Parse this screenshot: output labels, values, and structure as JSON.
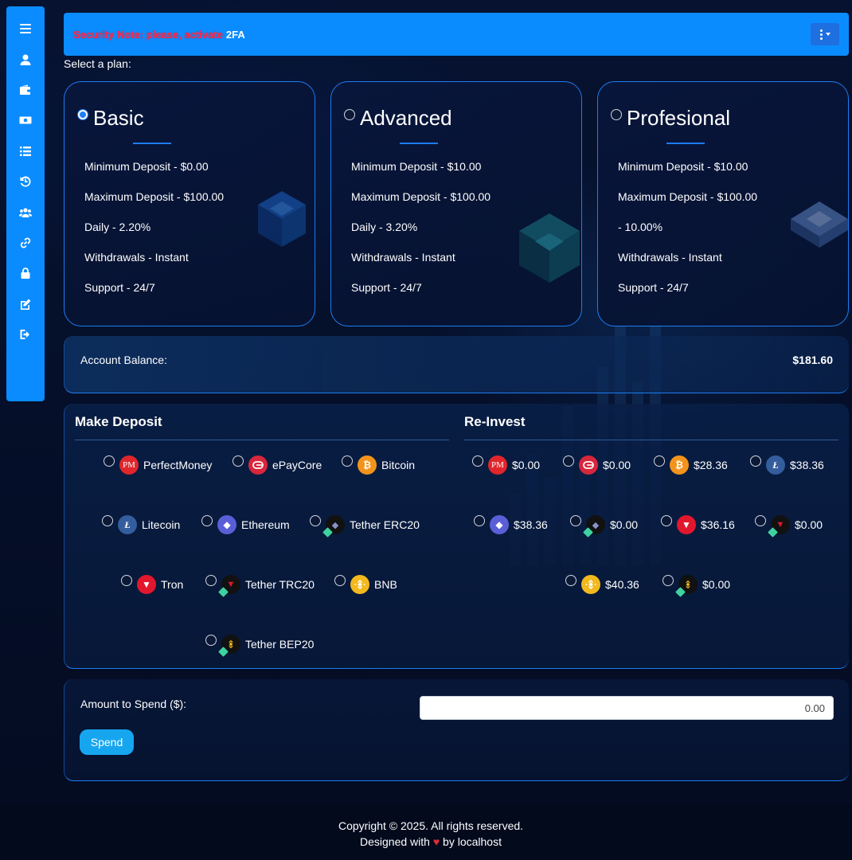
{
  "topbar": {
    "security_note": "Security Note: please, activate",
    "fa_link": "2FA"
  },
  "sidebar": {
    "items": [
      {
        "icon": "menu-icon"
      },
      {
        "icon": "user-icon"
      },
      {
        "icon": "wallet-icon"
      },
      {
        "icon": "money-icon"
      },
      {
        "icon": "list-icon"
      },
      {
        "icon": "history-icon"
      },
      {
        "icon": "users-icon"
      },
      {
        "icon": "link-icon"
      },
      {
        "icon": "lock-icon"
      },
      {
        "icon": "edit-icon"
      },
      {
        "icon": "logout-icon"
      }
    ]
  },
  "plans": {
    "label": "Select a plan:",
    "items": [
      {
        "name": "Basic",
        "selected": true,
        "lines": [
          "Minimum Deposit - $0.00",
          "Maximum Deposit - $100.00",
          "Daily - 2.20%",
          "Withdrawals - Instant",
          "Support - 24/7"
        ]
      },
      {
        "name": "Advanced",
        "selected": false,
        "lines": [
          "Minimum Deposit - $10.00",
          "Maximum Deposit - $100.00",
          "Daily - 3.20%",
          "Withdrawals - Instant",
          "Support - 24/7"
        ]
      },
      {
        "name": "Profesional",
        "selected": false,
        "lines": [
          "Minimum Deposit - $10.00",
          "Maximum Deposit - $100.00",
          "- 10.00%",
          "Withdrawals - Instant",
          "Support - 24/7"
        ]
      }
    ]
  },
  "balance": {
    "label": "Account Balance:",
    "value": "$181.60"
  },
  "deposit": {
    "title": "Make Deposit",
    "options": [
      {
        "label": "PerfectMoney",
        "coin": "pm"
      },
      {
        "label": "ePayCore",
        "coin": "epay"
      },
      {
        "label": "Bitcoin",
        "coin": "btc"
      },
      {
        "label": "Litecoin",
        "coin": "ltc"
      },
      {
        "label": "Ethereum",
        "coin": "eth"
      },
      {
        "label": "Tether ERC20",
        "coin": "usdt"
      },
      {
        "label": "Tron",
        "coin": "trx"
      },
      {
        "label": "Tether TRC20",
        "coin": "usdt-trc"
      },
      {
        "label": "BNB",
        "coin": "bnb"
      },
      {
        "label": "Tether BEP20",
        "coin": "usdt-bep"
      }
    ]
  },
  "reinvest": {
    "title": "Re-Invest",
    "options": [
      {
        "coin": "pm",
        "amount": "$0.00"
      },
      {
        "coin": "epay",
        "amount": "$0.00"
      },
      {
        "coin": "btc",
        "amount": "$28.36"
      },
      {
        "coin": "ltc",
        "amount": "$38.36"
      },
      {
        "coin": "eth",
        "amount": "$38.36"
      },
      {
        "coin": "usdt",
        "amount": "$0.00"
      },
      {
        "coin": "trx",
        "amount": "$36.16"
      },
      {
        "coin": "usdt-trc",
        "amount": "$0.00"
      },
      {
        "coin": "bnb",
        "amount": "$40.36"
      },
      {
        "coin": "usdt-bep",
        "amount": "$0.00"
      }
    ]
  },
  "coin_glyphs": {
    "pm": "PM",
    "btc": "₿",
    "ltc": "Ł",
    "eth": "◆",
    "trx": "▼"
  },
  "amount": {
    "label": "Amount to Spend ($):",
    "value": "0.00",
    "button": "Spend"
  },
  "footer": {
    "copyright": "Copyright © 2025. All rights reserved.",
    "designed_prefix": "Designed with",
    "heart": "♥",
    "designed_suffix": "by localhost"
  },
  "colors": {
    "accent": "#0a8cff",
    "background": "#040d24",
    "border": "#1d7cf2",
    "security_note": "#ff2d55",
    "button": "#16a6f0"
  }
}
